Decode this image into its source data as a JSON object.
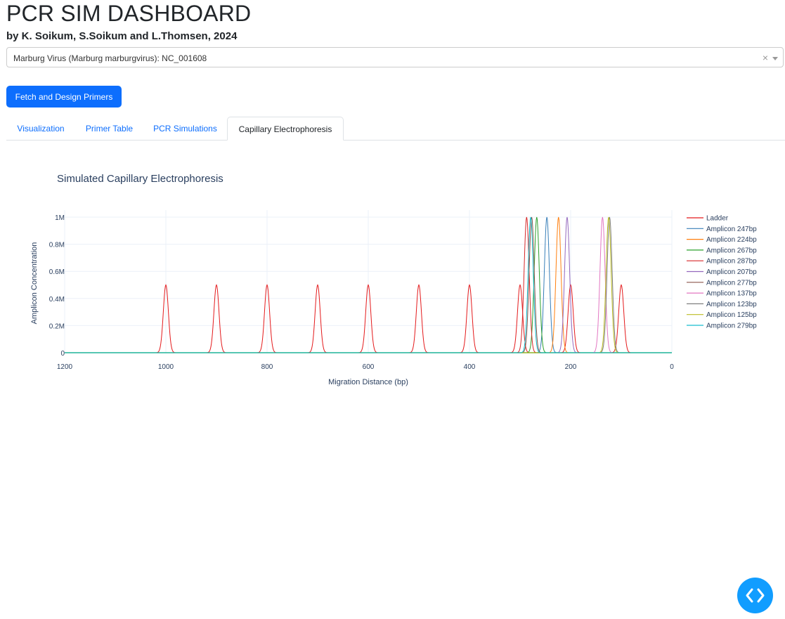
{
  "header": {
    "title": "PCR SIM DASHBOARD",
    "subtitle": "by K. Soikum, S.Soikum and L.Thomsen, 2024"
  },
  "virus_select": {
    "selected": "Marburg Virus (Marburg marburgvirus): NC_001608",
    "clear_glyph": "×"
  },
  "fetch_button": {
    "label": "Fetch and Design Primers"
  },
  "tabs": [
    {
      "label": "Visualization",
      "active": false
    },
    {
      "label": "Primer Table",
      "active": false
    },
    {
      "label": "PCR Simulations",
      "active": false
    },
    {
      "label": "Capillary Electrophoresis",
      "active": true
    }
  ],
  "debug_button": {
    "icon": "code-icon",
    "color": "#119dff"
  },
  "chart_data": {
    "type": "line",
    "title": "Simulated Capillary Electrophoresis",
    "xlabel": "Migration Distance (bp)",
    "ylabel": "Amplicon Concentration",
    "xlim": [
      1200,
      0
    ],
    "ylim": [
      0,
      1000000
    ],
    "x_ticks": [
      1200,
      1000,
      800,
      600,
      400,
      200,
      0
    ],
    "x_tick_labels": [
      "1200",
      "1000",
      "800",
      "600",
      "400",
      "200",
      "0"
    ],
    "y_ticks": [
      0,
      200000,
      400000,
      600000,
      800000,
      1000000
    ],
    "y_tick_labels": [
      "0",
      "0.2M",
      "0.4M",
      "0.6M",
      "0.8M",
      "1M"
    ],
    "grid": true,
    "legend_position": "right",
    "peak_shape": "gaussian",
    "series": [
      {
        "name": "Ladder",
        "color": "#e41a1c",
        "peaks_bp": [
          1000,
          900,
          800,
          700,
          600,
          500,
          400,
          300,
          200,
          100
        ],
        "height": 500000
      },
      {
        "name": "Amplicon 247bp",
        "color": "#377eb8",
        "peaks_bp": [
          247
        ],
        "height": 1000000
      },
      {
        "name": "Amplicon 224bp",
        "color": "#ff7f0e",
        "peaks_bp": [
          224
        ],
        "height": 1000000
      },
      {
        "name": "Amplicon 267bp",
        "color": "#2ca02c",
        "peaks_bp": [
          267
        ],
        "height": 1000000
      },
      {
        "name": "Amplicon 287bp",
        "color": "#d62728",
        "peaks_bp": [
          287
        ],
        "height": 1000000
      },
      {
        "name": "Amplicon 207bp",
        "color": "#9467bd",
        "peaks_bp": [
          207
        ],
        "height": 1000000
      },
      {
        "name": "Amplicon 277bp",
        "color": "#8c564b",
        "peaks_bp": [
          277
        ],
        "height": 1000000
      },
      {
        "name": "Amplicon 137bp",
        "color": "#e377c2",
        "peaks_bp": [
          137
        ],
        "height": 1000000
      },
      {
        "name": "Amplicon 123bp",
        "color": "#7f7f7f",
        "peaks_bp": [
          123
        ],
        "height": 1000000
      },
      {
        "name": "Amplicon 125bp",
        "color": "#bcbd22",
        "peaks_bp": [
          125
        ],
        "height": 1000000
      },
      {
        "name": "Amplicon 279bp",
        "color": "#17becf",
        "peaks_bp": [
          279
        ],
        "height": 1000000
      }
    ]
  }
}
